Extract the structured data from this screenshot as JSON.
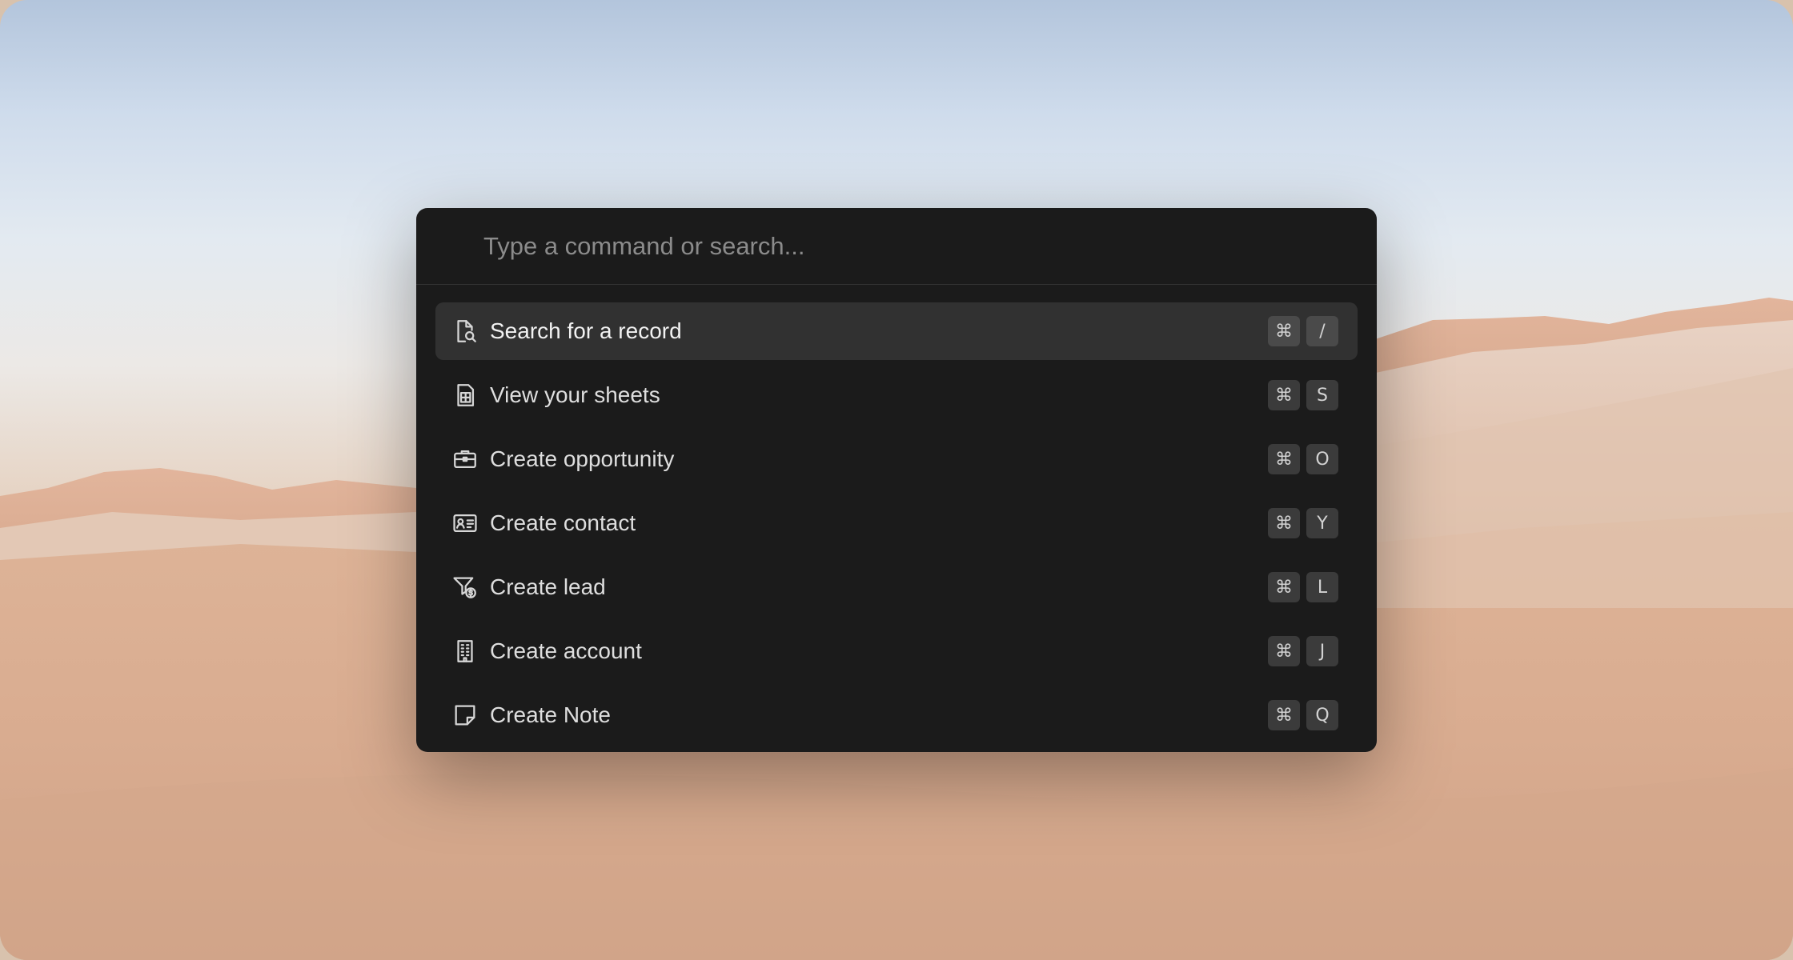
{
  "search": {
    "placeholder": "Type a command or search..."
  },
  "commands": [
    {
      "label": "Search for a record",
      "icon": "search-document-icon",
      "modifier": "⌘",
      "key": "/",
      "active": true
    },
    {
      "label": "View your sheets",
      "icon": "spreadsheet-icon",
      "modifier": "⌘",
      "key": "S",
      "active": false
    },
    {
      "label": "Create opportunity",
      "icon": "briefcase-icon",
      "modifier": "⌘",
      "key": "O",
      "active": false
    },
    {
      "label": "Create contact",
      "icon": "contact-card-icon",
      "modifier": "⌘",
      "key": "Y",
      "active": false
    },
    {
      "label": "Create lead",
      "icon": "funnel-dollar-icon",
      "modifier": "⌘",
      "key": "L",
      "active": false
    },
    {
      "label": "Create account",
      "icon": "building-icon",
      "modifier": "⌘",
      "key": "J",
      "active": false
    },
    {
      "label": "Create Note",
      "icon": "sticky-note-icon",
      "modifier": "⌘",
      "key": "Q",
      "active": false
    }
  ],
  "colors": {
    "palette_bg": "#1b1b1b",
    "active_row": "#313131",
    "key_bg": "#3b3b3b"
  }
}
